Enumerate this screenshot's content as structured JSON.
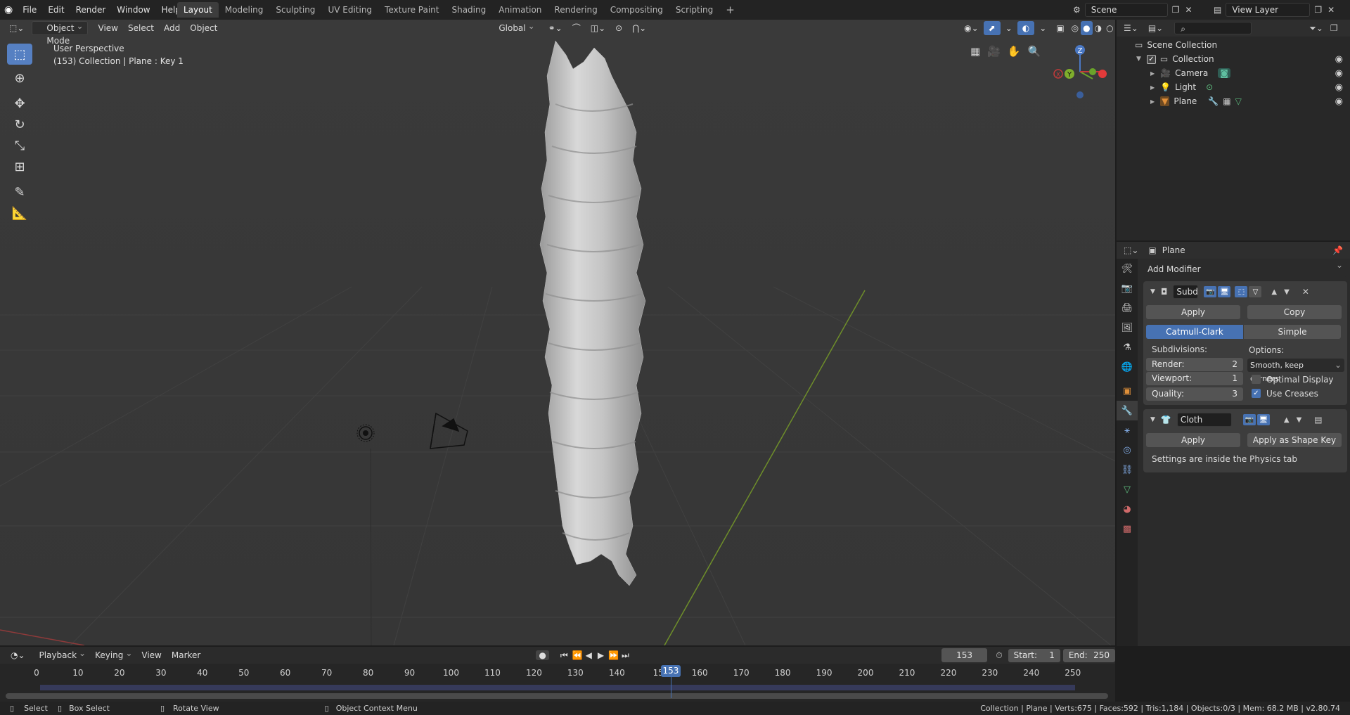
{
  "topbar": {
    "menus": [
      "File",
      "Edit",
      "Render",
      "Window",
      "Help"
    ],
    "workspaces": [
      "Layout",
      "Modeling",
      "Sculpting",
      "UV Editing",
      "Texture Paint",
      "Shading",
      "Animation",
      "Rendering",
      "Compositing",
      "Scripting"
    ],
    "active_workspace": "Layout",
    "add_tab": "+",
    "scene": "Scene",
    "view_layer": "View Layer"
  },
  "viewport": {
    "mode": "Object Mode",
    "menus": [
      "View",
      "Select",
      "Add",
      "Object"
    ],
    "orientation": "Global",
    "info_line1": "User Perspective",
    "info_line2": "(153) Collection | Plane : Key 1",
    "gizmo": {
      "z": "Z",
      "y": "Y",
      "x": "X"
    }
  },
  "outliner": {
    "search_placeholder": "",
    "root": "Scene Collection",
    "collection": "Collection",
    "items": [
      {
        "name": "Camera"
      },
      {
        "name": "Light"
      },
      {
        "name": "Plane"
      }
    ]
  },
  "properties": {
    "object_name": "Plane",
    "add_modifier": "Add Modifier",
    "subsurf": {
      "name": "Subd",
      "apply": "Apply",
      "copy": "Copy",
      "catmull": "Catmull-Clark",
      "simple": "Simple",
      "subdivisions_label": "Subdivisions:",
      "options_label": "Options:",
      "render_label": "Render:",
      "render_value": "2",
      "viewport_label": "Viewport:",
      "viewport_value": "1",
      "quality_label": "Quality:",
      "quality_value": "3",
      "uv_smooth": "Smooth, keep corners",
      "optimal_display": "Optimal Display",
      "use_creases": "Use Creases"
    },
    "cloth": {
      "name": "Cloth",
      "apply": "Apply",
      "apply_shape": "Apply as Shape Key",
      "note": "Settings are inside the Physics tab"
    }
  },
  "timeline": {
    "menus": [
      "Playback",
      "Keying",
      "View",
      "Marker"
    ],
    "current_frame": "153",
    "start_label": "Start:",
    "start": "1",
    "end_label": "End:",
    "end": "250",
    "ticks": [
      0,
      10,
      20,
      30,
      40,
      50,
      60,
      70,
      80,
      90,
      100,
      110,
      120,
      130,
      140,
      150,
      160,
      170,
      180,
      190,
      200,
      210,
      220,
      230,
      240,
      250
    ],
    "tick_labels": [
      "0",
      "10",
      "20",
      "30",
      "40",
      "50",
      "60",
      "70",
      "80",
      "90",
      "100",
      "110",
      "120",
      "130",
      "140",
      "15",
      "160",
      "170",
      "180",
      "190",
      "200",
      "210",
      "220",
      "230",
      "240",
      "250"
    ],
    "playhead_label": "153"
  },
  "statusbar": {
    "select": "Select",
    "box_select": "Box Select",
    "rotate_view": "Rotate View",
    "context_menu": "Object Context Menu",
    "stats": "Collection | Plane | Verts:675 | Faces:592 | Tris:1,184 | Objects:0/3 | Mem: 68.2 MB | v2.80.74"
  }
}
